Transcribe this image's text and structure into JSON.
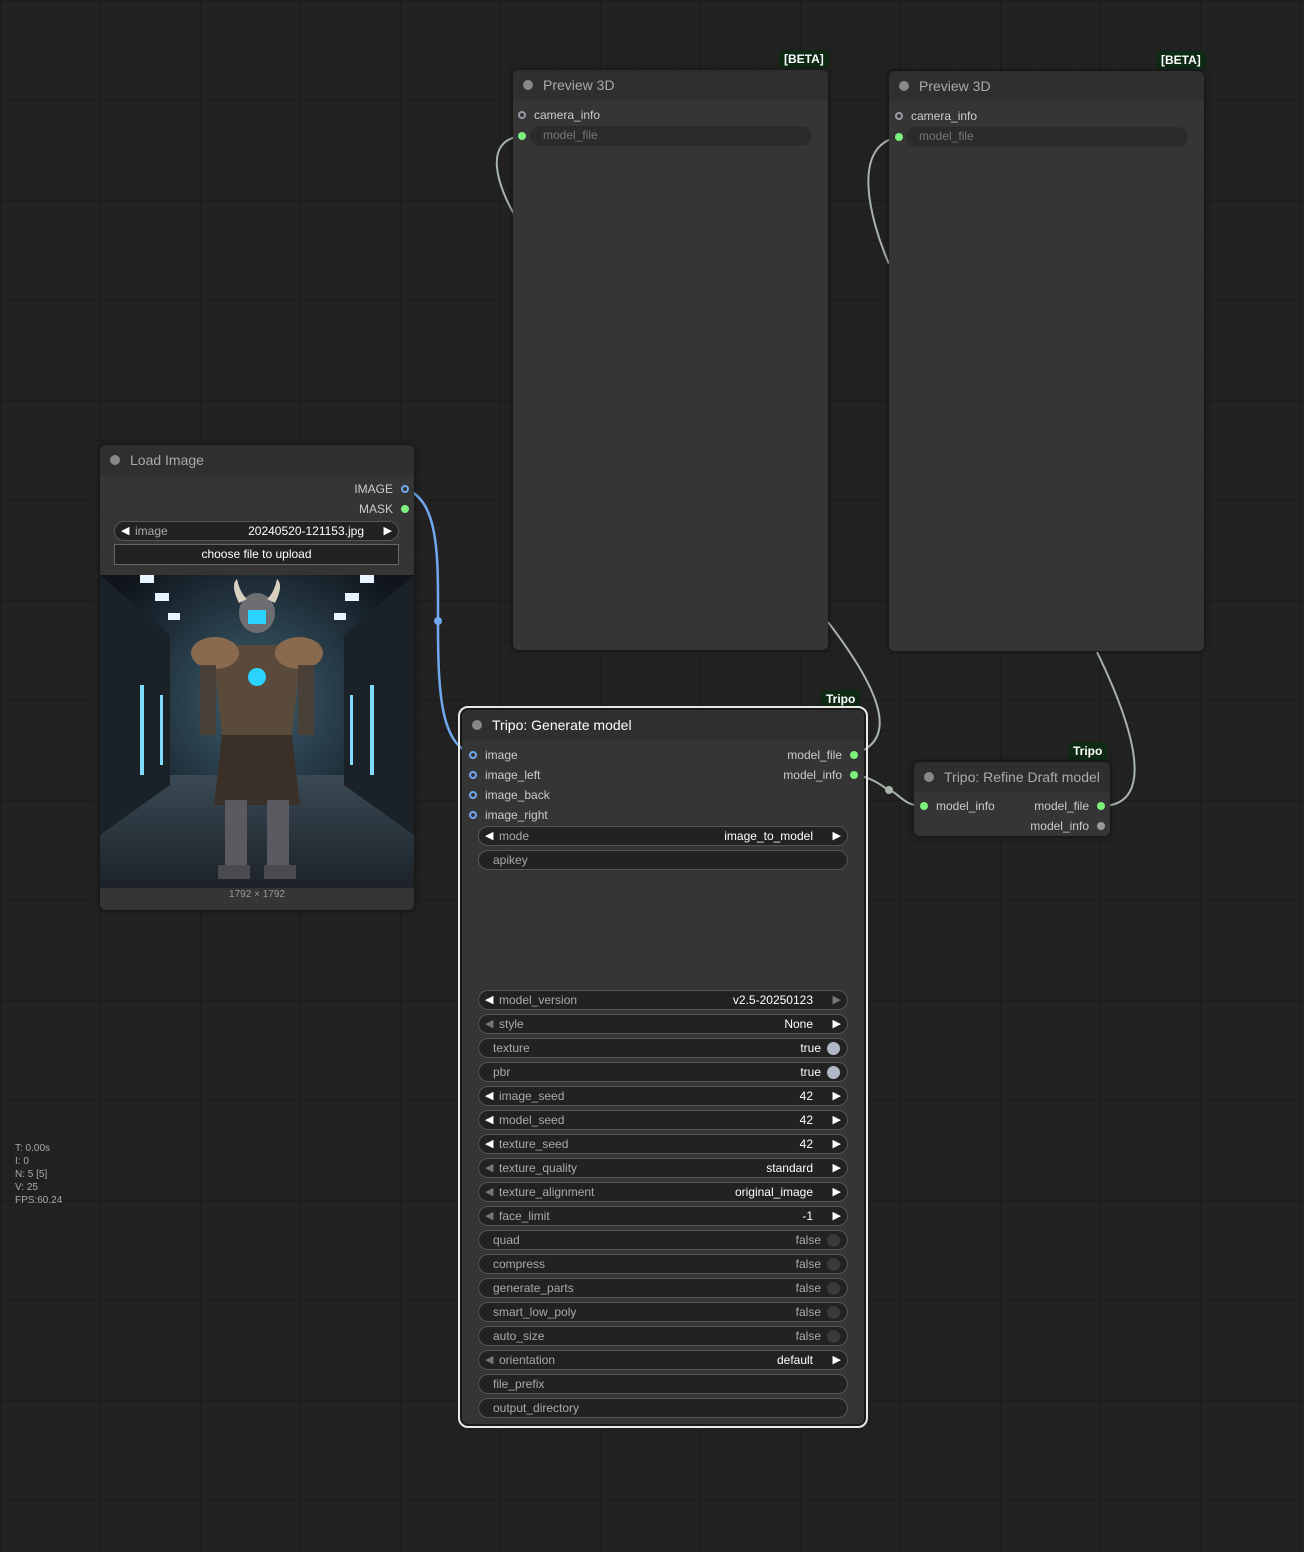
{
  "colors": {
    "canvas": "#222222",
    "node_body": "#353535",
    "node_title": "#2f2f2f",
    "badge": "#0e2a15",
    "link_image": "#70a8ee",
    "link_model": "#a8b4a8"
  },
  "nodes": {
    "preview1": {
      "title": "Preview 3D",
      "badge": "[BETA]",
      "inputs": {
        "camera_info": "camera_info",
        "model_file": "model_file"
      }
    },
    "preview2": {
      "title": "Preview 3D",
      "badge": "[BETA]",
      "inputs": {
        "camera_info": "camera_info",
        "model_file": "model_file"
      }
    },
    "load_image": {
      "title": "Load Image",
      "outputs": {
        "image": "IMAGE",
        "mask": "MASK"
      },
      "image_widget": {
        "label": "image",
        "value": "20240520-121153.jpg"
      },
      "upload_button": "choose file to upload",
      "image_size": "1792 × 1792"
    },
    "generate": {
      "title": "Tripo: Generate model",
      "badge": "Tripo",
      "inputs": [
        "image",
        "image_left",
        "image_back",
        "image_right"
      ],
      "outputs": [
        "model_file",
        "model_info"
      ],
      "widgets": {
        "mode": {
          "label": "mode",
          "value": "image_to_model"
        },
        "apikey": {
          "label": "apikey"
        },
        "model_version": {
          "label": "model_version",
          "value": "v2.5-20250123"
        },
        "style": {
          "label": "style",
          "value": "None"
        },
        "texture": {
          "label": "texture",
          "value": "true"
        },
        "pbr": {
          "label": "pbr",
          "value": "true"
        },
        "image_seed": {
          "label": "image_seed",
          "value": "42"
        },
        "model_seed": {
          "label": "model_seed",
          "value": "42"
        },
        "texture_seed": {
          "label": "texture_seed",
          "value": "42"
        },
        "texture_quality": {
          "label": "texture_quality",
          "value": "standard"
        },
        "texture_alignment": {
          "label": "texture_alignment",
          "value": "original_image"
        },
        "face_limit": {
          "label": "face_limit",
          "value": "-1"
        },
        "quad": {
          "label": "quad",
          "value": "false"
        },
        "compress": {
          "label": "compress",
          "value": "false"
        },
        "generate_parts": {
          "label": "generate_parts",
          "value": "false"
        },
        "smart_low_poly": {
          "label": "smart_low_poly",
          "value": "false"
        },
        "auto_size": {
          "label": "auto_size",
          "value": "false"
        },
        "orientation": {
          "label": "orientation",
          "value": "default"
        },
        "file_prefix": {
          "label": "file_prefix"
        },
        "output_directory": {
          "label": "output_directory"
        }
      }
    },
    "refine": {
      "title": "Tripo: Refine Draft model",
      "badge": "Tripo",
      "inputs": [
        "model_info"
      ],
      "outputs": [
        "model_file",
        "model_info"
      ]
    }
  },
  "stats": {
    "t": "T: 0.00s",
    "i": "I: 0",
    "n": "N: 5 [5]",
    "v": "V: 25",
    "fps": "FPS:60.24"
  }
}
